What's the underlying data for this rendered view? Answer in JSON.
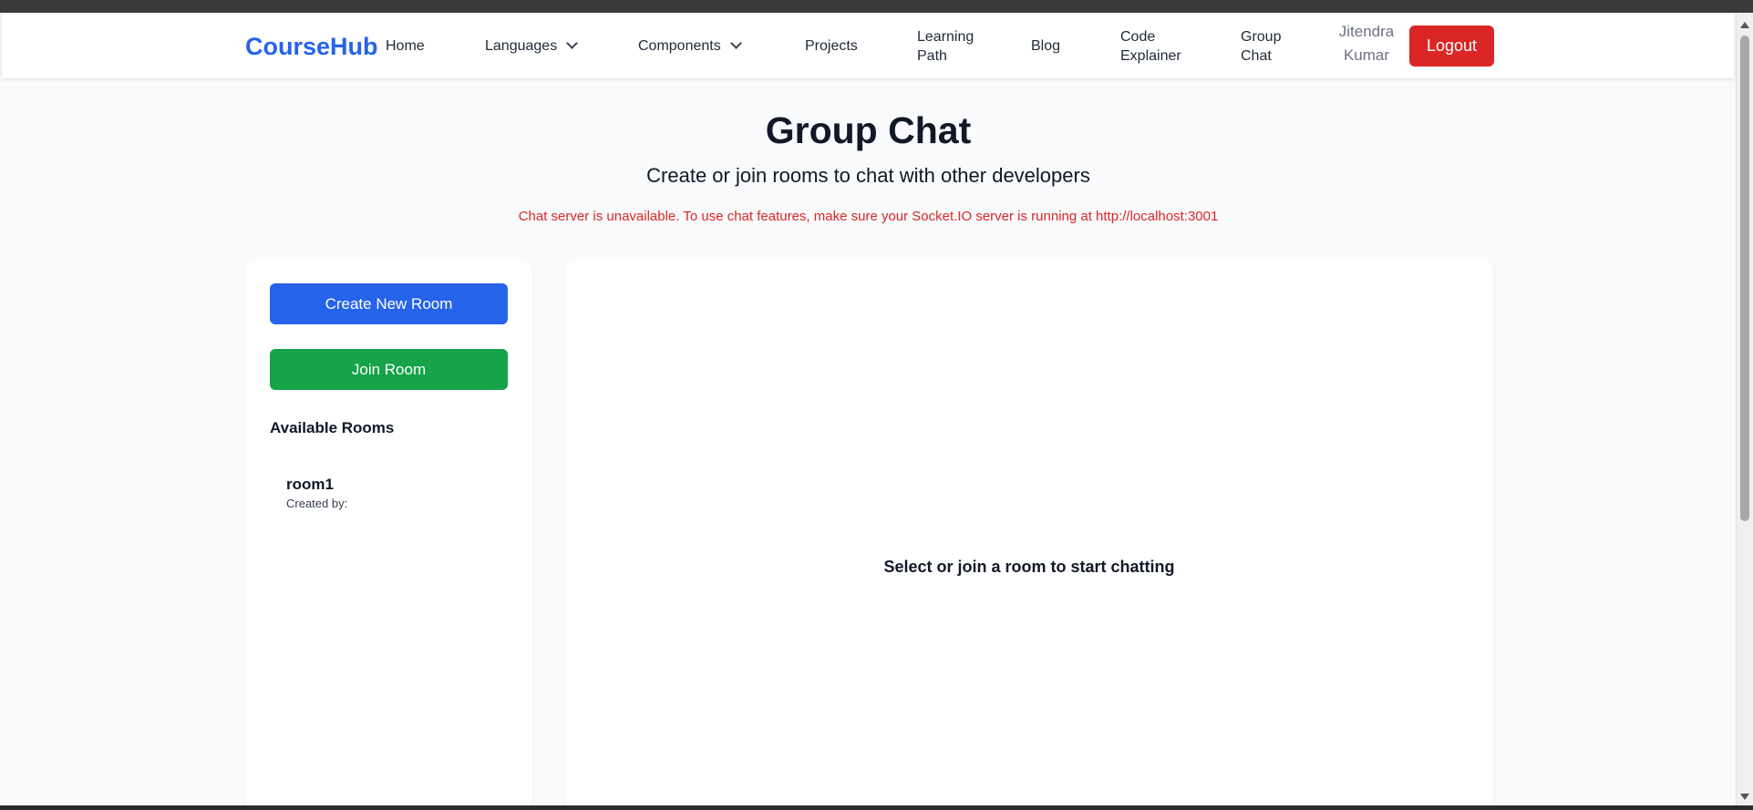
{
  "navbar": {
    "brand": "CourseHub",
    "items": [
      {
        "label": "Home"
      },
      {
        "label": "Languages",
        "icon": "chevron-down-icon"
      },
      {
        "label": "Components",
        "icon": "chevron-down-icon"
      },
      {
        "label": "Projects"
      },
      {
        "label_line1": "Learning",
        "label_line2": "Path"
      },
      {
        "label": "Blog"
      },
      {
        "label_line1": "Code",
        "label_line2": "Explainer"
      },
      {
        "label_line1": "Group",
        "label_line2": "Chat"
      }
    ],
    "user_first": "Jitendra",
    "user_last": "Kumar",
    "logout_label": "Logout"
  },
  "header": {
    "title": "Group Chat",
    "subtitle": "Create or join rooms to chat with other developers",
    "error": "Chat server is unavailable. To use chat features, make sure your Socket.IO server is running at http://localhost:3001"
  },
  "sidebar": {
    "create_label": "Create New Room",
    "join_label": "Join Room",
    "rooms_heading": "Available Rooms",
    "rooms": [
      {
        "name": "room1",
        "meta": "Created by:"
      }
    ]
  },
  "chat": {
    "placeholder": "Select or join a room to start chatting"
  },
  "colors": {
    "brand": "#2563eb",
    "create_button": "#2563eb",
    "join_button": "#16a34a",
    "logout_button": "#dc2626",
    "error_text": "#dc2626",
    "page_background": "#f8fafc"
  }
}
